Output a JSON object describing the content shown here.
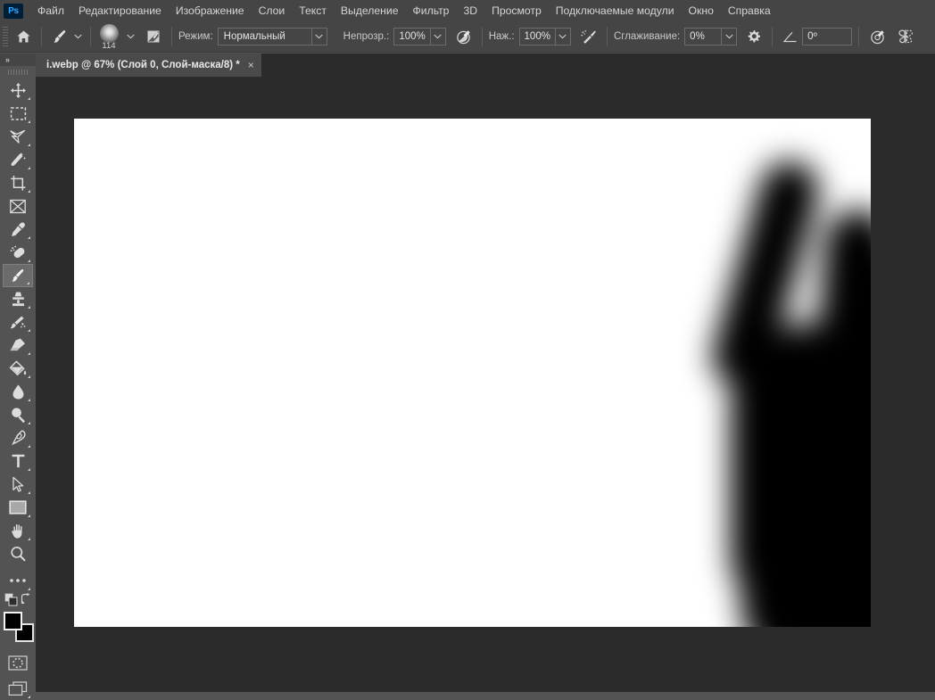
{
  "app": {
    "name": "Adobe Photoshop",
    "logo_text": "Ps",
    "theme_bg": "#535353",
    "panel_bg": "#454545",
    "canvas_bg": "#2b2b2b",
    "accent": "#31a8ff"
  },
  "menubar": {
    "items": [
      {
        "label": "Файл",
        "name": "menu-file"
      },
      {
        "label": "Редактирование",
        "name": "menu-edit"
      },
      {
        "label": "Изображение",
        "name": "menu-image"
      },
      {
        "label": "Слои",
        "name": "menu-layers"
      },
      {
        "label": "Текст",
        "name": "menu-type"
      },
      {
        "label": "Выделение",
        "name": "menu-select"
      },
      {
        "label": "Фильтр",
        "name": "menu-filter"
      },
      {
        "label": "3D",
        "name": "menu-3d"
      },
      {
        "label": "Просмотр",
        "name": "menu-view"
      },
      {
        "label": "Подключаемые модули",
        "name": "menu-plugins"
      },
      {
        "label": "Окно",
        "name": "menu-window"
      },
      {
        "label": "Справка",
        "name": "menu-help"
      }
    ]
  },
  "options_bar": {
    "home_icon": "home-icon",
    "tool_icon": "brush-tool-icon",
    "brush_size": "114",
    "brush_panel_icon": "brush-settings-icon",
    "mode_label": "Режим:",
    "mode_value": "Нормальный",
    "opacity_label": "Непрозр.:",
    "opacity_value": "100%",
    "opacity_pressure_icon": "pressure-opacity-icon",
    "flow_label": "Наж.:",
    "flow_value": "100%",
    "airbrush_icon": "airbrush-icon",
    "smoothing_label": "Сглаживание:",
    "smoothing_value": "0%",
    "smoothing_gear_icon": "gear-icon",
    "angle_icon": "angle-icon",
    "angle_value": "0º",
    "pressure_size_icon": "pressure-size-icon",
    "symmetry_icon": "symmetry-butterfly-icon"
  },
  "document_tab": {
    "title": "i.webp @ 67% (Слой 0, Слой-маска/8) *",
    "close_glyph": "×"
  },
  "toolbar": {
    "collapse_glyph": "»",
    "tools": [
      {
        "name": "move-tool",
        "label": "Перемещение",
        "icon": "move-icon",
        "has_submenu": true,
        "active": false
      },
      {
        "name": "marquee-tool",
        "label": "Прямоугольная область",
        "icon": "marquee-icon",
        "has_submenu": true,
        "active": false
      },
      {
        "name": "lasso-tool",
        "label": "Лассо",
        "icon": "lasso-icon",
        "has_submenu": true,
        "active": false
      },
      {
        "name": "quick-selection-tool",
        "label": "Быстрое выделение",
        "icon": "magic-wand-icon",
        "has_submenu": true,
        "active": false
      },
      {
        "name": "crop-tool",
        "label": "Рамка",
        "icon": "crop-icon",
        "has_submenu": true,
        "active": false
      },
      {
        "name": "frame-tool",
        "label": "Кадр",
        "icon": "frame-icon",
        "has_submenu": false,
        "active": false
      },
      {
        "name": "eyedropper-tool",
        "label": "Пипетка",
        "icon": "eyedropper-icon",
        "has_submenu": true,
        "active": false
      },
      {
        "name": "healing-brush-tool",
        "label": "Восстанавливающая кисть",
        "icon": "healing-brush-icon",
        "has_submenu": true,
        "active": false
      },
      {
        "name": "brush-tool",
        "label": "Кисть",
        "icon": "brush-icon",
        "has_submenu": true,
        "active": true
      },
      {
        "name": "clone-stamp-tool",
        "label": "Штамп",
        "icon": "clone-stamp-icon",
        "has_submenu": true,
        "active": false
      },
      {
        "name": "history-brush-tool",
        "label": "Архивная кисть",
        "icon": "history-brush-icon",
        "has_submenu": true,
        "active": false
      },
      {
        "name": "eraser-tool",
        "label": "Ластик",
        "icon": "eraser-icon",
        "has_submenu": true,
        "active": false
      },
      {
        "name": "gradient-tool",
        "label": "Заливка",
        "icon": "paint-bucket-icon",
        "has_submenu": true,
        "active": false
      },
      {
        "name": "blur-tool",
        "label": "Размытие",
        "icon": "blur-drop-icon",
        "has_submenu": true,
        "active": false
      },
      {
        "name": "dodge-tool",
        "label": "Осветлитель",
        "icon": "dodge-icon",
        "has_submenu": true,
        "active": false
      },
      {
        "name": "pen-tool",
        "label": "Перо",
        "icon": "pen-icon",
        "has_submenu": true,
        "active": false
      },
      {
        "name": "type-tool",
        "label": "Горизонтальный текст",
        "icon": "type-t-icon",
        "has_submenu": true,
        "active": false
      },
      {
        "name": "path-selection-tool",
        "label": "Выделение контура",
        "icon": "path-arrow-icon",
        "has_submenu": true,
        "active": false
      },
      {
        "name": "rectangle-tool",
        "label": "Прямоугольник",
        "icon": "rectangle-icon",
        "has_submenu": true,
        "active": false
      },
      {
        "name": "hand-tool",
        "label": "Рука",
        "icon": "hand-icon",
        "has_submenu": true,
        "active": false
      },
      {
        "name": "zoom-tool",
        "label": "Масштаб",
        "icon": "zoom-magnifier-icon",
        "has_submenu": false,
        "active": false
      },
      {
        "name": "edit-toolbar",
        "label": "Редактировать панель инструментов",
        "icon": "ellipsis-icon",
        "has_submenu": true,
        "active": false
      }
    ],
    "default_colors_icon": "default-colors-icon",
    "swap-colors_icon": "swap-colors-icon",
    "foreground_color": "#000000",
    "background_color": "#000000",
    "quickmask_icon": "quick-mask-icon",
    "screenmode_icon": "screen-mode-icon"
  },
  "canvas": {
    "zoom": "67%",
    "document_color": "#ffffff",
    "artwork_description": "Размытый чёрный силуэт руки у правого края холста"
  }
}
